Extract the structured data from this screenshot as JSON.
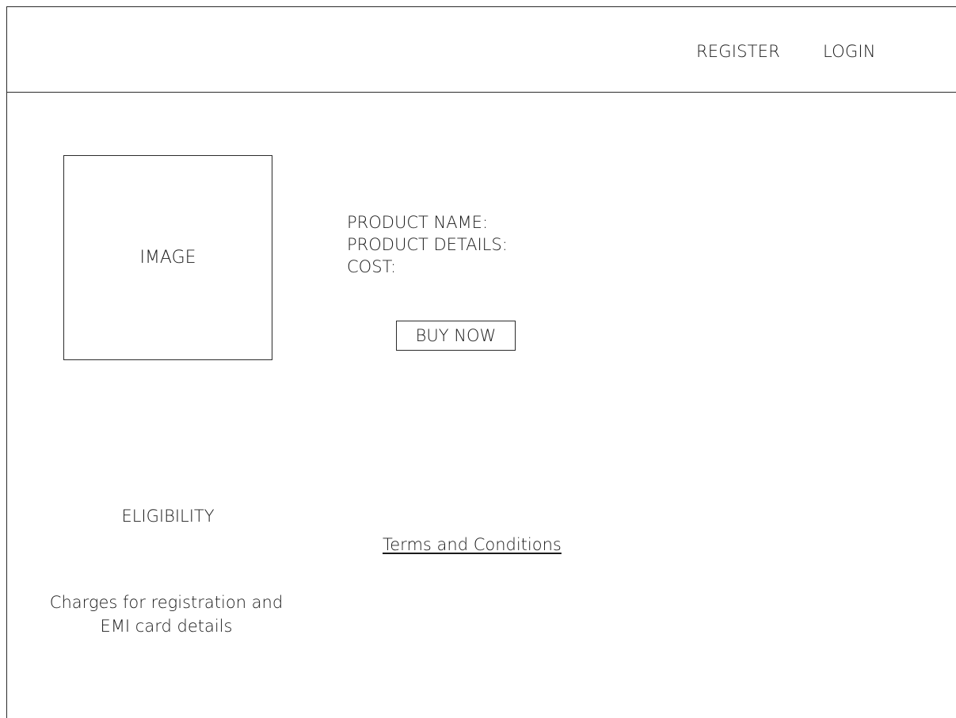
{
  "header": {
    "register_label": "REGISTER",
    "login_label": "LOGIN"
  },
  "product": {
    "image_placeholder": "IMAGE",
    "name_label": "PRODUCT NAME:",
    "details_label": "PRODUCT DETAILS:",
    "cost_label": "COST:",
    "buy_now_label": "BUY NOW"
  },
  "footer": {
    "eligibility_label": "ELIGIBILITY",
    "terms_link": "Terms and Conditions",
    "charges_line1": "Charges for registration and",
    "charges_line2": "EMI card details"
  }
}
